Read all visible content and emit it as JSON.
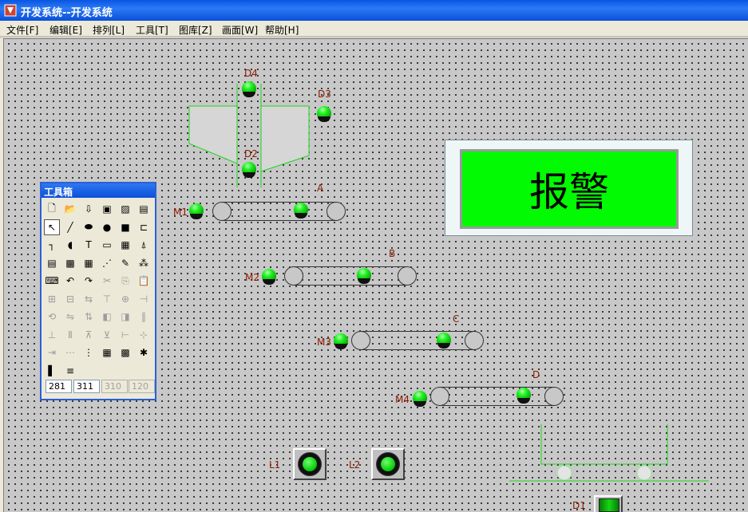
{
  "window": {
    "title": "开发系统--开发系统"
  },
  "menu": [
    "文件[F]",
    "编辑[E]",
    "排列[L]",
    "工具[T]",
    "图库[Z]",
    "画面[W]",
    "帮助[H]"
  ],
  "canvas": {
    "labels": {
      "d4": "D4",
      "d3": "D3",
      "d2": "D2",
      "d1": "D1",
      "a": "A",
      "b": "B",
      "c": "C",
      "d": "D",
      "m1": "M1",
      "m2": "M2",
      "m3": "M3",
      "m4": "M4",
      "l1": "L1",
      "l2": "L2"
    },
    "alarm": {
      "text": "报警",
      "color": "#02fa02"
    },
    "lamp_color": "#27f527",
    "label_color": "#8b1a00"
  },
  "toolbox": {
    "title": "工具箱",
    "coords": [
      "281",
      "311",
      "310",
      "120"
    ],
    "tools": [
      {
        "icon": "new-file-icon",
        "glyph": "🗋"
      },
      {
        "icon": "open-folder-icon",
        "glyph": "📂"
      },
      {
        "icon": "import-icon",
        "glyph": "⇩"
      },
      {
        "icon": "save-icon",
        "glyph": "▣"
      },
      {
        "icon": "picture-icon",
        "glyph": "▨"
      },
      {
        "icon": "screen-icon",
        "glyph": "▤"
      },
      {
        "icon": "pointer-icon",
        "glyph": "↖"
      },
      {
        "icon": "line-icon",
        "glyph": "╱"
      },
      {
        "icon": "ellipse-filled-icon",
        "glyph": "⬬"
      },
      {
        "icon": "circle-icon",
        "glyph": "●"
      },
      {
        "icon": "rectangle-icon",
        "glyph": "■"
      },
      {
        "icon": "polyline-icon",
        "glyph": "⊏"
      },
      {
        "icon": "pipe-icon",
        "glyph": "┐"
      },
      {
        "icon": "arc-icon",
        "glyph": "◖"
      },
      {
        "icon": "text-icon",
        "glyph": "T"
      },
      {
        "icon": "rounded-rect-icon",
        "glyph": "▭"
      },
      {
        "icon": "report-icon",
        "glyph": "▦"
      },
      {
        "icon": "gauge-icon",
        "glyph": "⍋"
      },
      {
        "icon": "document-icon",
        "glyph": "▤"
      },
      {
        "icon": "image-icon",
        "glyph": "▩"
      },
      {
        "icon": "grid-icon",
        "glyph": "▦"
      },
      {
        "icon": "chart-icon",
        "glyph": "⋰"
      },
      {
        "icon": "edit-icon",
        "glyph": "✎"
      },
      {
        "icon": "scatter-icon",
        "glyph": "⁂"
      },
      {
        "icon": "keyboard-icon",
        "glyph": "⌨"
      },
      {
        "icon": "undo-icon",
        "glyph": "↶"
      },
      {
        "icon": "redo-icon",
        "glyph": "↷"
      },
      {
        "icon": "cut-icon",
        "glyph": "✂"
      },
      {
        "icon": "copy-icon",
        "glyph": "⎘"
      },
      {
        "icon": "paste-icon",
        "glyph": "📋"
      },
      {
        "icon": "group-icon",
        "glyph": "⊞"
      },
      {
        "icon": "ungroup-icon",
        "glyph": "⊟"
      },
      {
        "icon": "align-icon",
        "glyph": "⇆"
      },
      {
        "icon": "align-top-icon",
        "glyph": "⊤"
      },
      {
        "icon": "align-center-icon",
        "glyph": "⊕"
      },
      {
        "icon": "align-right-icon",
        "glyph": "⊣"
      },
      {
        "icon": "rotate-icon",
        "glyph": "⟲"
      },
      {
        "icon": "flip-icon",
        "glyph": "⇋"
      },
      {
        "icon": "mirror-icon",
        "glyph": "⇅"
      },
      {
        "icon": "front-icon",
        "glyph": "◧"
      },
      {
        "icon": "back-icon",
        "glyph": "◨"
      },
      {
        "icon": "bars-icon",
        "glyph": "‖"
      },
      {
        "icon": "distribute-h-icon",
        "glyph": "⊥"
      },
      {
        "icon": "distribute-v-icon",
        "glyph": "Ⅱ"
      },
      {
        "icon": "same-width-icon",
        "glyph": "⊼"
      },
      {
        "icon": "same-height-icon",
        "glyph": "⊻"
      },
      {
        "icon": "align-left-icon",
        "glyph": "⊢"
      },
      {
        "icon": "center-icon",
        "glyph": "⊹"
      },
      {
        "icon": "space-icon",
        "glyph": "⇥"
      },
      {
        "icon": "dots-h-icon",
        "glyph": "⋯"
      },
      {
        "icon": "dots-v-icon",
        "glyph": "⋮"
      },
      {
        "icon": "grid-dots-icon",
        "glyph": "▦"
      },
      {
        "icon": "palette-icon",
        "glyph": "▩"
      },
      {
        "icon": "pattern-icon",
        "glyph": "✱"
      },
      {
        "icon": "fill-icon",
        "glyph": "▌"
      },
      {
        "icon": "line-width-icon",
        "glyph": "≡"
      }
    ]
  }
}
